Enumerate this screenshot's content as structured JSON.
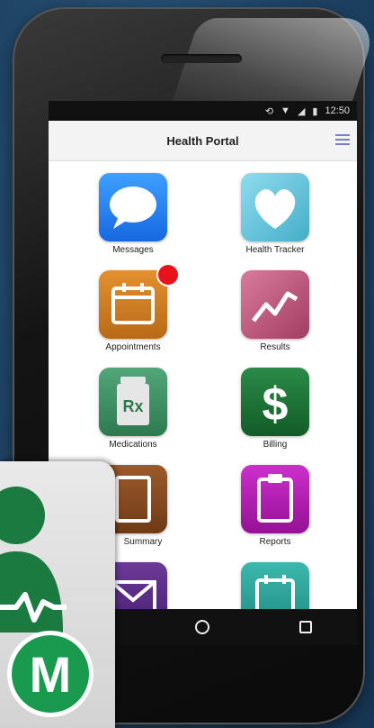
{
  "status_bar": {
    "time": "12:50"
  },
  "header": {
    "title": "Health Portal"
  },
  "tiles": [
    {
      "label": "Messages",
      "icon": "speech-bubble-icon",
      "color": "#1f7ff2"
    },
    {
      "label": "Health Tracker",
      "icon": "heart-icon",
      "color": "#63c6dd"
    },
    {
      "label": "Appointments",
      "icon": "calendar-icon",
      "color": "#cc7a21",
      "badge": true
    },
    {
      "label": "Results",
      "icon": "trend-chart-icon",
      "color": "#c2577b"
    },
    {
      "label": "Medications",
      "icon": "rx-bottle-icon",
      "color": "#3c8c5f"
    },
    {
      "label": "Billing",
      "icon": "dollar-icon",
      "color": "#1b6b34"
    },
    {
      "label": "Summary",
      "icon": "document-icon",
      "color": "#8a4b24"
    },
    {
      "label": "Reports",
      "icon": "clipboard-icon",
      "color": "#b51bb5"
    },
    {
      "label": "",
      "icon": "mail-icon",
      "color": "#5a2a85"
    },
    {
      "label": "",
      "icon": "calendar-add-icon",
      "color": "#2aa39a"
    }
  ],
  "logo": {
    "letter": "M",
    "icon": "medical-app-logo-icon",
    "color": "#1a8a4a"
  },
  "colors": {
    "accent": "#7b7ec8",
    "badge": "#e8121b"
  }
}
